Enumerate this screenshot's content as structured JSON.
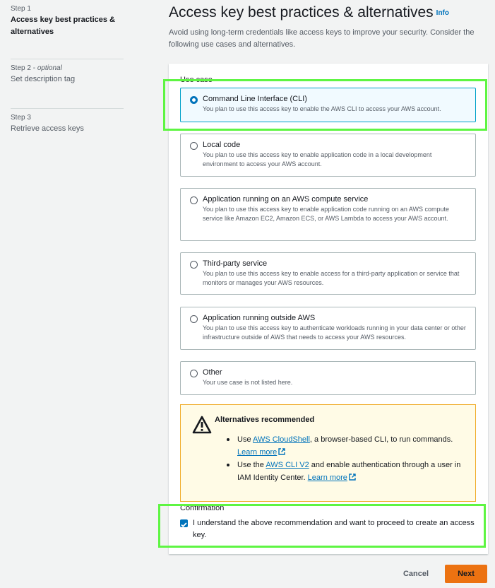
{
  "nav": {
    "steps": [
      {
        "label": "Step 1",
        "title": "Access key best practices & alternatives"
      },
      {
        "label": "Step 2 - ",
        "optional": "optional",
        "title": "Set description tag"
      },
      {
        "label": "Step 3",
        "title": "Retrieve access keys"
      }
    ]
  },
  "header": {
    "title": "Access key best practices & alternatives",
    "info": "Info",
    "description": "Avoid using long-term credentials like access keys to improve your security. Consider the following use cases and alternatives."
  },
  "use_case": {
    "label": "Use case",
    "selected": "Command Line Interface (CLI)",
    "options": [
      {
        "title": "Command Line Interface (CLI)",
        "desc": "You plan to use this access key to enable the AWS CLI to access your AWS account."
      },
      {
        "title": "Local code",
        "desc": "You plan to use this access key to enable application code in a local development environment to access your AWS account."
      },
      {
        "title": "Application running on an AWS compute service",
        "desc": "You plan to use this access key to enable application code running on an AWS compute service like Amazon EC2, Amazon ECS, or AWS Lambda to access your AWS account."
      },
      {
        "title": "Third-party service",
        "desc": "You plan to use this access key to enable access for a third-party application or service that monitors or manages your AWS resources."
      },
      {
        "title": "Application running outside AWS",
        "desc": "You plan to use this access key to authenticate workloads running in your data center or other infrastructure outside of AWS that needs to access your AWS resources."
      },
      {
        "title": "Other",
        "desc": "Your use case is not listed here."
      }
    ]
  },
  "alert": {
    "title": "Alternatives recommended",
    "item1_pre": "Use ",
    "item1_link": "AWS CloudShell",
    "item1_post": ", a browser-based CLI, to run commands.",
    "item1_learn": "Learn more",
    "item2_pre": "Use the ",
    "item2_link": "AWS CLI V2",
    "item2_post": " and enable authentication through a user in IAM Identity Center.",
    "item2_learn": "Learn more"
  },
  "confirmation": {
    "label": "Confirmation",
    "checked": true,
    "text": "I understand the above recommendation and want to proceed to create an access key."
  },
  "footer": {
    "cancel": "Cancel",
    "next": "Next"
  },
  "colors": {
    "accent": "#0073bb",
    "primary_button": "#ec7211",
    "highlight": "#5ef542",
    "warning_bg": "#fffbe6"
  }
}
